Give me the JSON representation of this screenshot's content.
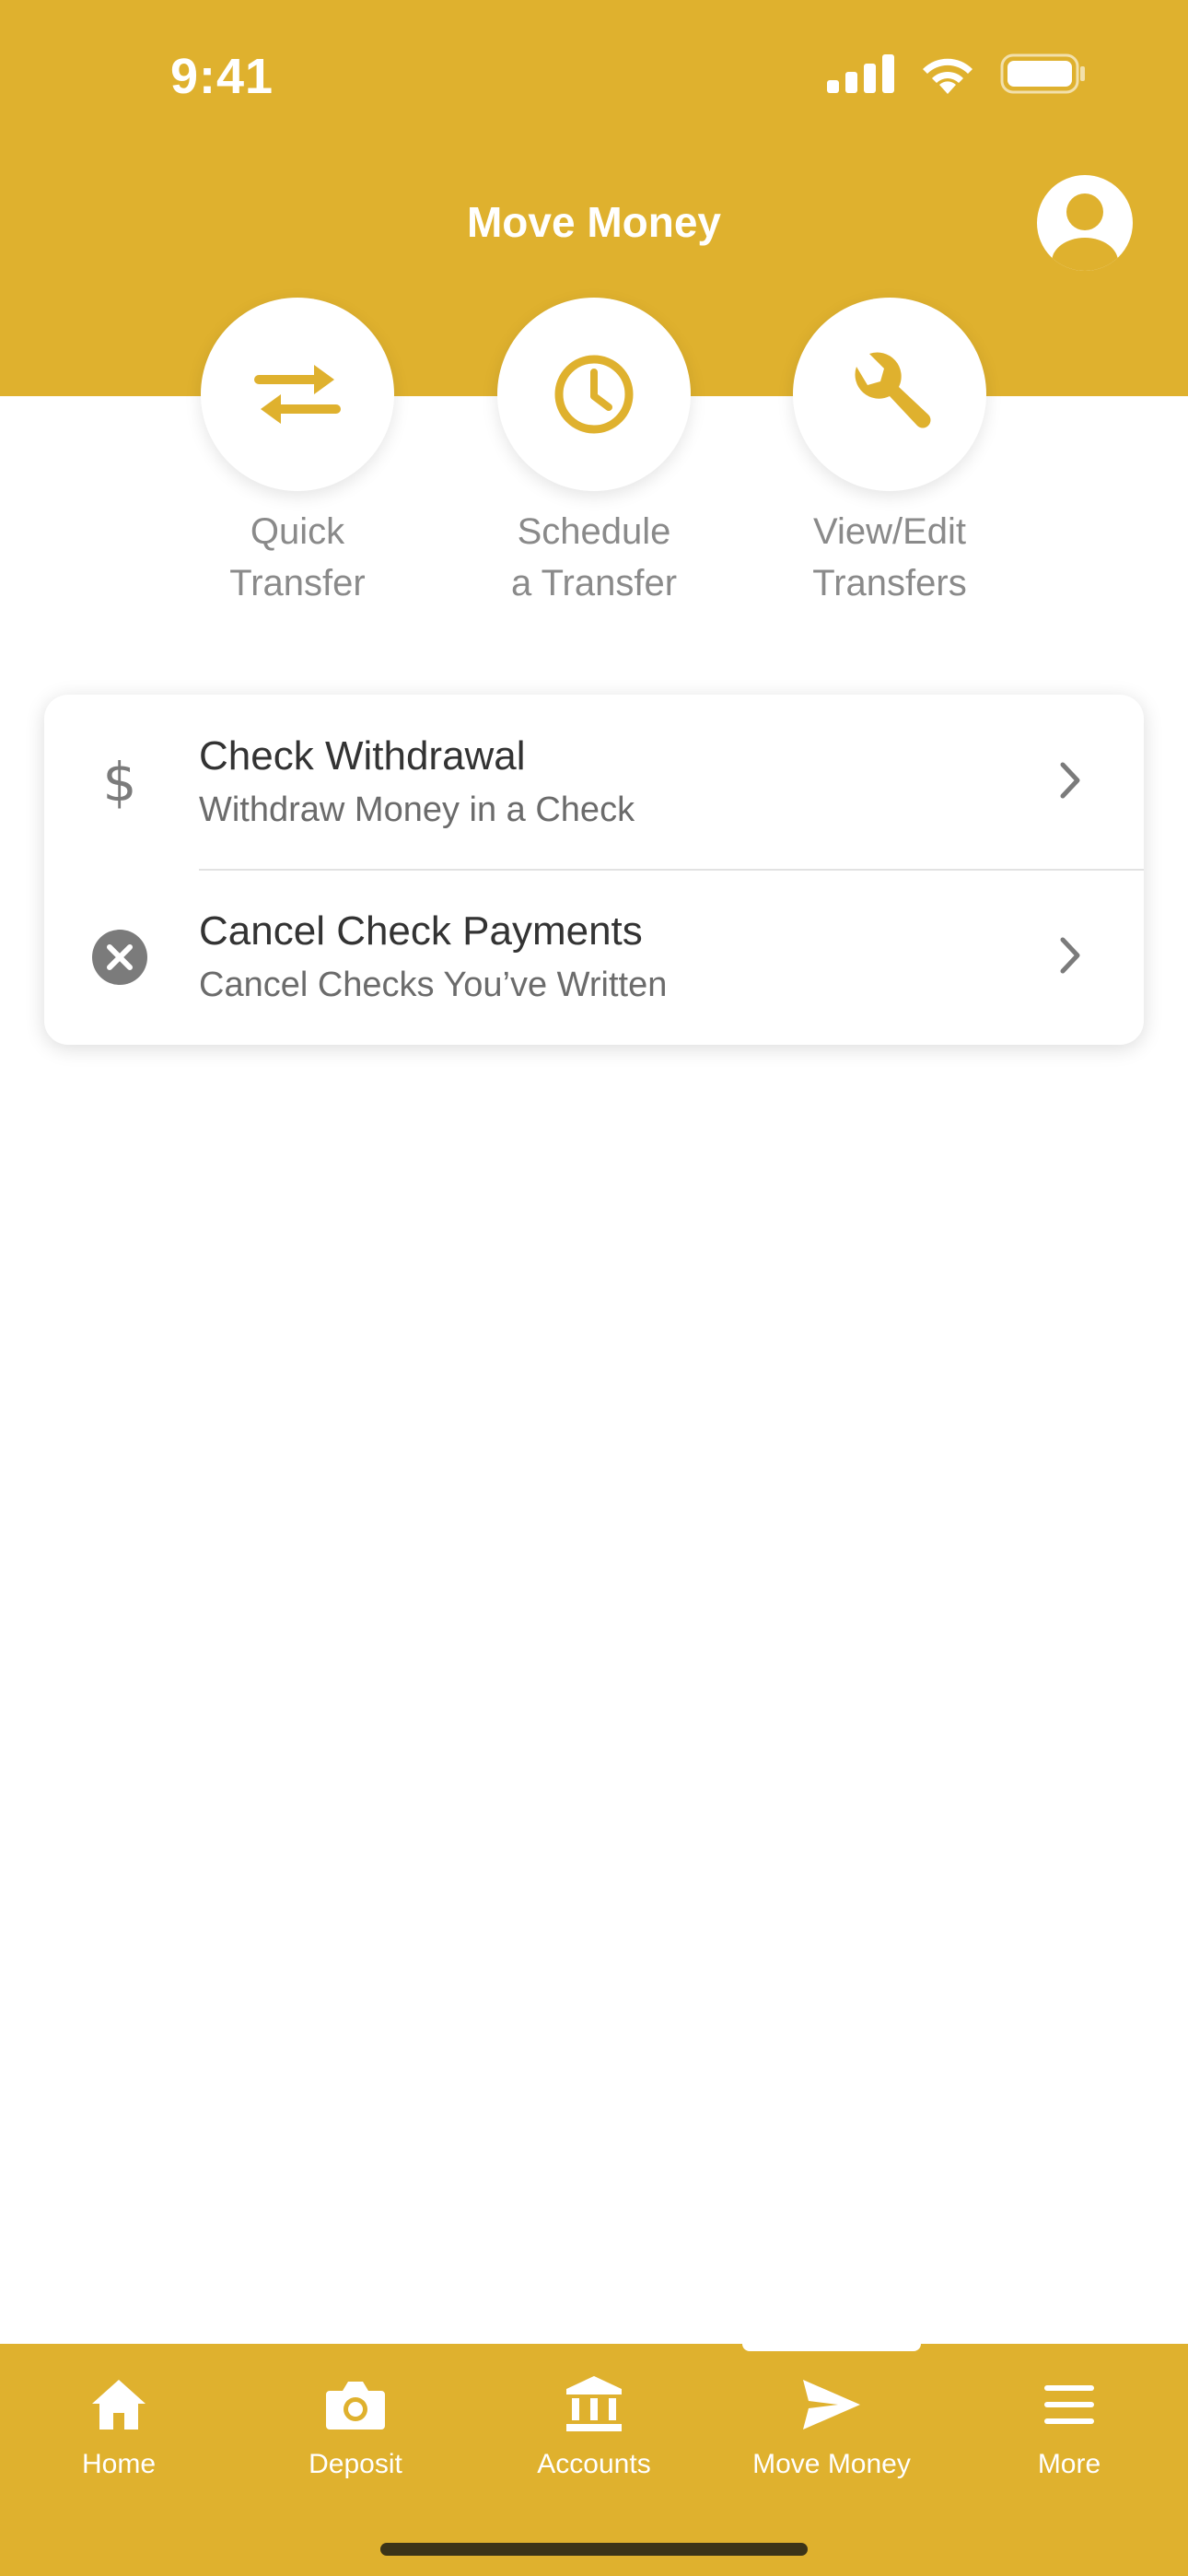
{
  "status_bar": {
    "time": "9:41"
  },
  "header": {
    "title": "Move Money",
    "profile_icon": "user-circle-icon"
  },
  "actions": [
    {
      "label": "Quick\nTransfer",
      "icon": "transfer-arrows-icon"
    },
    {
      "label": "Schedule\na Transfer",
      "icon": "clock-icon"
    },
    {
      "label": "View/Edit\nTransfers",
      "icon": "wrench-icon"
    }
  ],
  "menu": [
    {
      "title": "Check Withdrawal",
      "subtitle": "Withdraw Money in a Check",
      "icon": "dollar-icon"
    },
    {
      "title": "Cancel Check Payments",
      "subtitle": "Cancel Checks You’ve Written",
      "icon": "cancel-circle-icon"
    }
  ],
  "tabs": [
    {
      "label": "Home",
      "icon": "home-icon"
    },
    {
      "label": "Deposit",
      "icon": "camera-icon"
    },
    {
      "label": "Accounts",
      "icon": "bank-icon"
    },
    {
      "label": "Move Money",
      "icon": "send-icon",
      "active": true
    },
    {
      "label": "More",
      "icon": "menu-icon"
    }
  ],
  "colors": {
    "brand": "#DFB12E",
    "text": "#333333",
    "muted": "#8A8A8A",
    "icon_gray": "#7B7B7B"
  }
}
